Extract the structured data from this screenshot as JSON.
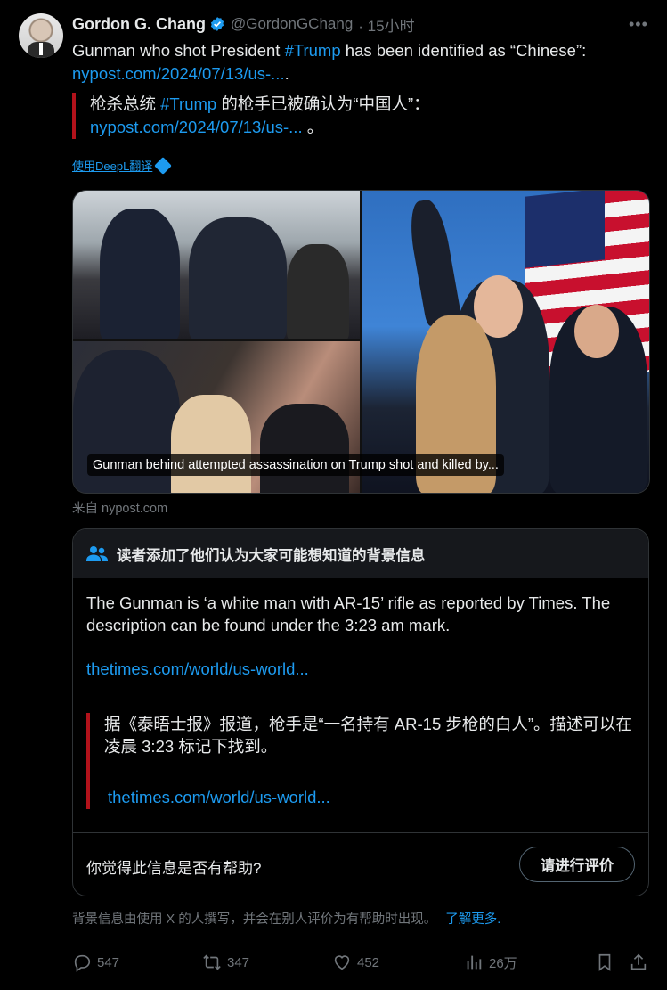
{
  "author": {
    "name": "Gordon G. Chang",
    "handle": "@GordonGChang",
    "time": "· 15小时"
  },
  "tweet": {
    "text_before": "Gunman who shot President ",
    "hashtag": "#Trump",
    "text_after": " has been identified as “Chinese”:",
    "link": "nypost.com/2024/07/13/us-...",
    "link_suffix": "."
  },
  "translation": {
    "text_before": "枪杀总统 ",
    "hashtag": "#Trump",
    "text_after": " 的枪手已被确认为“中国人”：",
    "link": "nypost.com/2024/07/13/us-...",
    "link_suffix": " 。",
    "deepl_label": "使用DeepL翻译"
  },
  "media": {
    "caption": "Gunman behind attempted assassination on Trump shot and killed by...",
    "source": "来自 nypost.com"
  },
  "community_note": {
    "header": "读者添加了他们认为大家可能想知道的背景信息",
    "body": "The Gunman is ‘a white man with AR-15’ rifle as reported by Times. The description can be found under the 3:23 am mark.",
    "link": "thetimes.com/world/us-world...",
    "quote_text": "据《泰晤士报》报道，枪手是“一名持有 AR-15 步枪的白人”。描述可以在凌晨 3:23 标记下找到。",
    "quote_link": "thetimes.com/world/us-world...",
    "helpful_question": "你觉得此信息是否有帮助?",
    "rate_button": "请进行评价"
  },
  "footnote": {
    "text": "背景信息由使用 X 的人撰写，并会在别人评价为有帮助时出现。",
    "learn_more": "了解更多."
  },
  "actions": {
    "replies": "547",
    "reposts": "347",
    "likes": "452",
    "views": "26万"
  },
  "colors": {
    "accent": "#1d9bf0",
    "quote_bar": "#b2121b",
    "muted": "#71767b"
  }
}
